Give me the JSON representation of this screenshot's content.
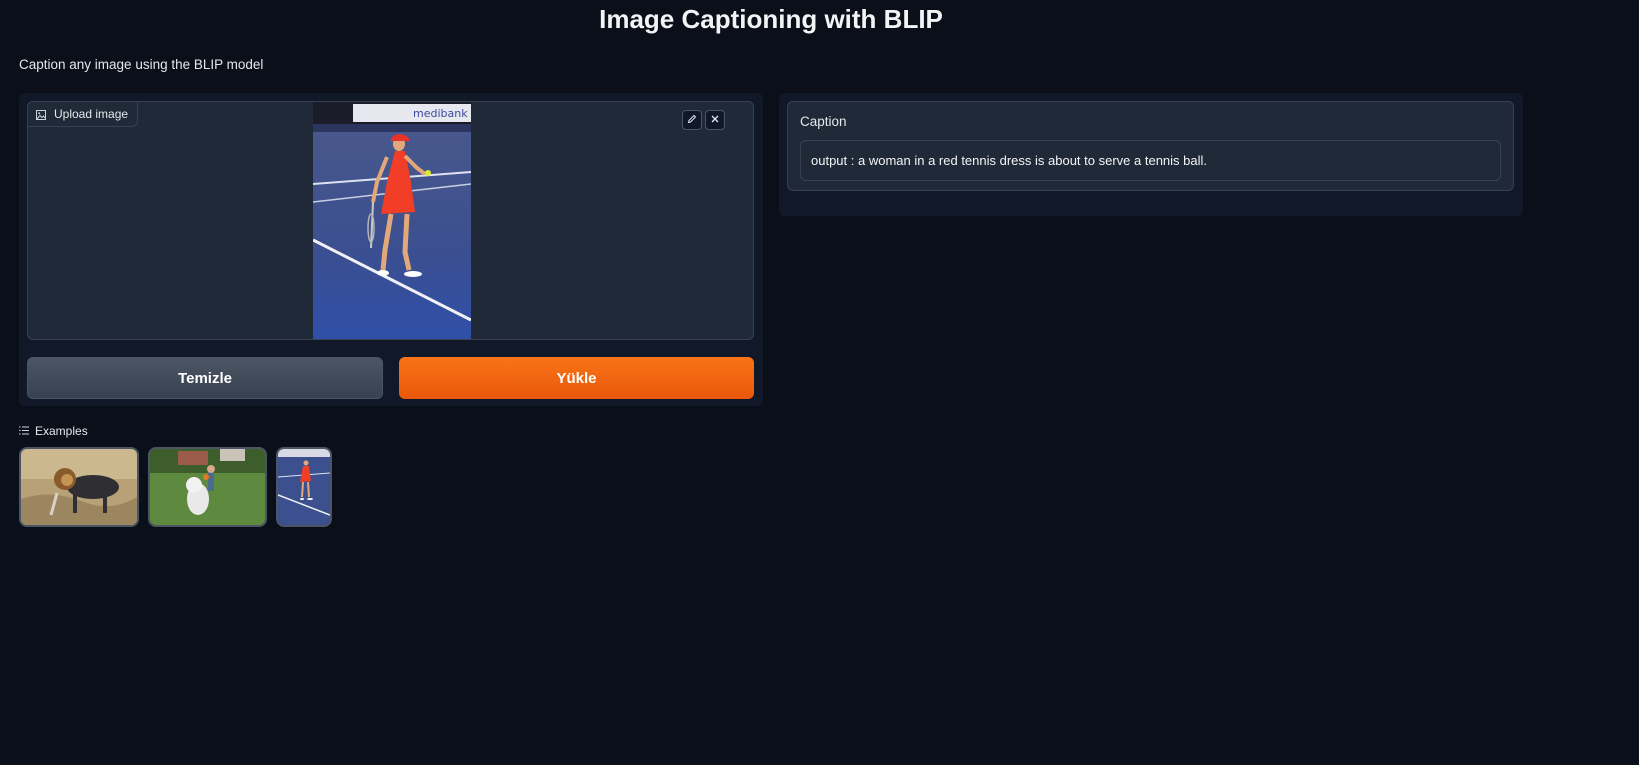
{
  "app": {
    "title": "Image Captioning with BLIP",
    "description": "Caption any image using the BLIP model"
  },
  "input": {
    "label": "Upload image",
    "icons": {
      "label": "image-icon",
      "edit": "pencil-icon",
      "remove": "close-icon"
    },
    "photo_banner_text": "medibank"
  },
  "buttons": {
    "clear": "Temizle",
    "submit": "Yükle"
  },
  "output": {
    "label": "Caption",
    "value": "output : a woman in a red tennis dress is about to serve a tennis ball."
  },
  "examples": {
    "label": "Examples",
    "items": [
      "lion-example",
      "dog-example",
      "tennis-example"
    ]
  },
  "colors": {
    "background": "#0b0f19",
    "panel": "#111827",
    "block": "#1f2937",
    "primary": "#f97316",
    "secondary": "#4b5563"
  }
}
